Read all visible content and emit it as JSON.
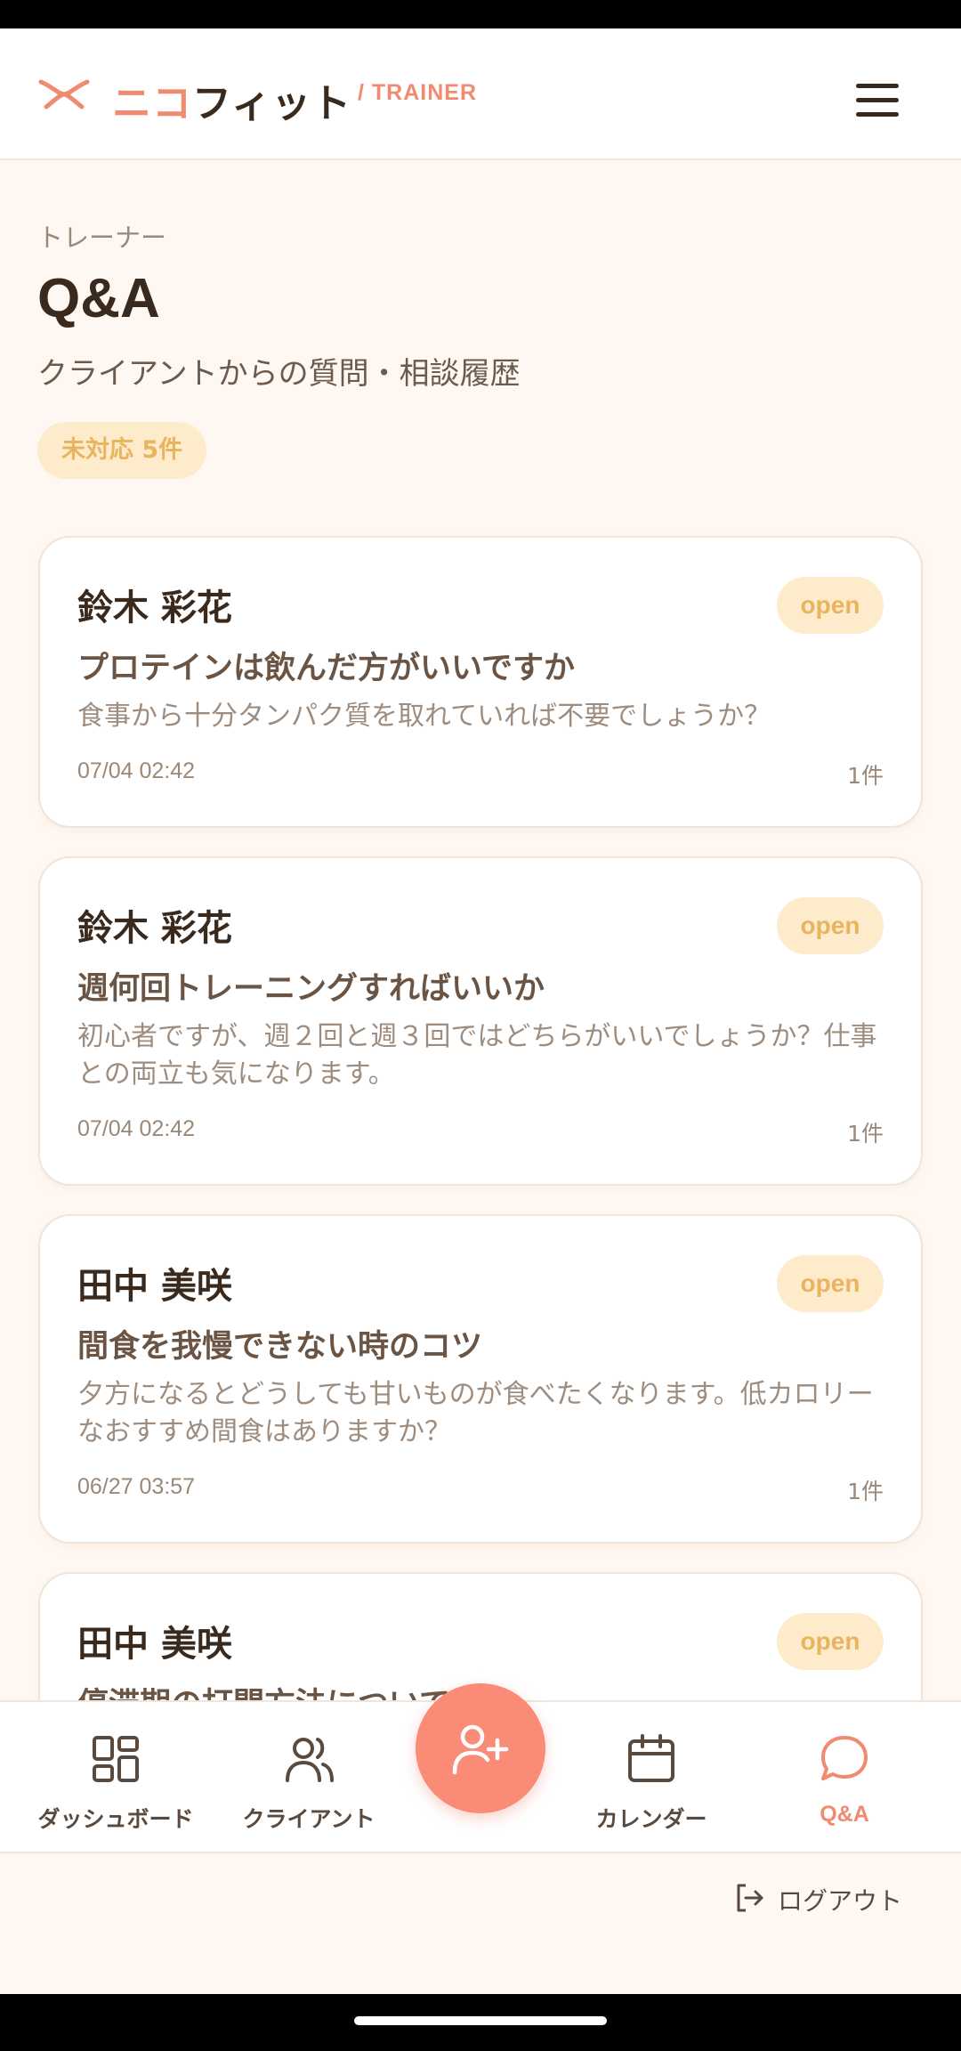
{
  "header": {
    "brand_part1": "ニコ",
    "brand_part2": "フィット",
    "brand_sub": "/ TRAINER",
    "logo_icon": "ribbon-logo-icon",
    "menu_icon": "hamburger-menu-icon"
  },
  "page": {
    "eyebrow": "トレーナー",
    "title": "Q&A",
    "subtitle": "クライアントからの質問・相談履歴",
    "pending_badge": "未対応 5件"
  },
  "questions": [
    {
      "author": "鈴木 彩花",
      "status": "open",
      "subject": "プロテインは飲んだ方がいいですか",
      "body": "食事から十分タンパク質を取れていれば不要でしょうか？",
      "date": "07/04 02:42",
      "count": "1件"
    },
    {
      "author": "鈴木 彩花",
      "status": "open",
      "subject": "週何回トレーニングすればいいか",
      "body": "初心者ですが、週２回と週３回ではどちらがいいでしょうか？仕事との両立も気になります。",
      "date": "07/04 02:42",
      "count": "1件"
    },
    {
      "author": "田中 美咲",
      "status": "open",
      "subject": "間食を我慢できない時のコツ",
      "body": "夕方になるとどうしても甘いものが食べたくなります。低カロリーなおすすめ間食はありますか？",
      "date": "06/27 03:57",
      "count": "1件"
    },
    {
      "author": "田中 美咲",
      "status": "open",
      "subject": "停滞期の打開方法について",
      "body": "",
      "date": "",
      "count": ""
    }
  ],
  "nav": {
    "items": [
      {
        "label": "ダッシュボード",
        "icon": "dashboard-grid-icon",
        "active": false
      },
      {
        "label": "クライアント",
        "icon": "users-icon",
        "active": false
      },
      {
        "label": "カレンダー",
        "icon": "calendar-icon",
        "active": false
      },
      {
        "label": "Q&A",
        "icon": "chat-bubble-icon",
        "active": true
      }
    ],
    "fab_icon": "add-user-icon"
  },
  "logout": {
    "label": "ログアウト",
    "icon": "logout-icon"
  },
  "colors": {
    "accent": "#F08A70",
    "fab": "#FA8B76",
    "badge_bg": "#FDEBCB",
    "badge_text": "#E9B45E",
    "background": "#FFF8F2",
    "text_dark": "#3A2A1E"
  }
}
